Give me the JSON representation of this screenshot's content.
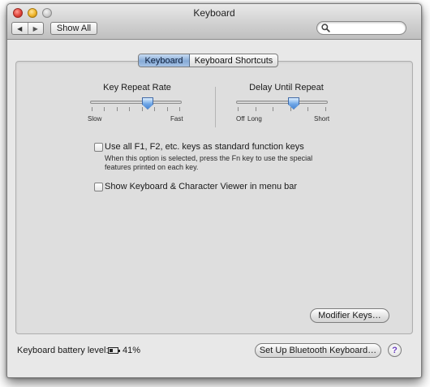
{
  "window": {
    "title": "Keyboard"
  },
  "toolbar": {
    "back_glyph": "◀",
    "forward_glyph": "▶",
    "show_all_label": "Show All",
    "search_value": "",
    "search_placeholder": ""
  },
  "tabs": [
    {
      "label": "Keyboard",
      "selected": true
    },
    {
      "label": "Keyboard Shortcuts",
      "selected": false
    }
  ],
  "key_repeat": {
    "label": "Key Repeat Rate",
    "min_label": "Slow",
    "max_label": "Fast",
    "tick_count": 8,
    "value": 0.63
  },
  "delay_repeat": {
    "label": "Delay Until Repeat",
    "min_label": "Off",
    "min_label_2": "Long",
    "max_label": "Short",
    "tick_count": 6,
    "value": 0.63
  },
  "fn_keys": {
    "label": "Use all F1, F2, etc. keys as standard function keys",
    "checked": false,
    "note_line1": "When this option is selected, press the Fn key to use the special",
    "note_line2": "features printed on each key."
  },
  "viewer": {
    "label": "Show Keyboard & Character Viewer in menu bar",
    "checked": false
  },
  "modifier_button_label": "Modifier Keys…",
  "battery": {
    "label": "Keyboard battery level:",
    "percent_text": "41%",
    "level": 0.41
  },
  "bluetooth_button_label": "Set Up Bluetooth Keyboard…",
  "help_glyph": "?"
}
